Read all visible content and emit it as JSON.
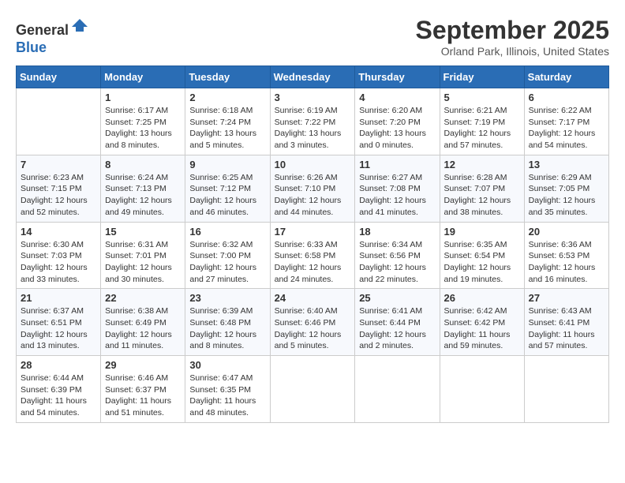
{
  "header": {
    "logo_line1": "General",
    "logo_line2": "Blue",
    "month": "September 2025",
    "location": "Orland Park, Illinois, United States"
  },
  "weekdays": [
    "Sunday",
    "Monday",
    "Tuesday",
    "Wednesday",
    "Thursday",
    "Friday",
    "Saturday"
  ],
  "weeks": [
    [
      {
        "day": "",
        "sunrise": "",
        "sunset": "",
        "daylight": ""
      },
      {
        "day": "1",
        "sunrise": "Sunrise: 6:17 AM",
        "sunset": "Sunset: 7:25 PM",
        "daylight": "Daylight: 13 hours and 8 minutes."
      },
      {
        "day": "2",
        "sunrise": "Sunrise: 6:18 AM",
        "sunset": "Sunset: 7:24 PM",
        "daylight": "Daylight: 13 hours and 5 minutes."
      },
      {
        "day": "3",
        "sunrise": "Sunrise: 6:19 AM",
        "sunset": "Sunset: 7:22 PM",
        "daylight": "Daylight: 13 hours and 3 minutes."
      },
      {
        "day": "4",
        "sunrise": "Sunrise: 6:20 AM",
        "sunset": "Sunset: 7:20 PM",
        "daylight": "Daylight: 13 hours and 0 minutes."
      },
      {
        "day": "5",
        "sunrise": "Sunrise: 6:21 AM",
        "sunset": "Sunset: 7:19 PM",
        "daylight": "Daylight: 12 hours and 57 minutes."
      },
      {
        "day": "6",
        "sunrise": "Sunrise: 6:22 AM",
        "sunset": "Sunset: 7:17 PM",
        "daylight": "Daylight: 12 hours and 54 minutes."
      }
    ],
    [
      {
        "day": "7",
        "sunrise": "Sunrise: 6:23 AM",
        "sunset": "Sunset: 7:15 PM",
        "daylight": "Daylight: 12 hours and 52 minutes."
      },
      {
        "day": "8",
        "sunrise": "Sunrise: 6:24 AM",
        "sunset": "Sunset: 7:13 PM",
        "daylight": "Daylight: 12 hours and 49 minutes."
      },
      {
        "day": "9",
        "sunrise": "Sunrise: 6:25 AM",
        "sunset": "Sunset: 7:12 PM",
        "daylight": "Daylight: 12 hours and 46 minutes."
      },
      {
        "day": "10",
        "sunrise": "Sunrise: 6:26 AM",
        "sunset": "Sunset: 7:10 PM",
        "daylight": "Daylight: 12 hours and 44 minutes."
      },
      {
        "day": "11",
        "sunrise": "Sunrise: 6:27 AM",
        "sunset": "Sunset: 7:08 PM",
        "daylight": "Daylight: 12 hours and 41 minutes."
      },
      {
        "day": "12",
        "sunrise": "Sunrise: 6:28 AM",
        "sunset": "Sunset: 7:07 PM",
        "daylight": "Daylight: 12 hours and 38 minutes."
      },
      {
        "day": "13",
        "sunrise": "Sunrise: 6:29 AM",
        "sunset": "Sunset: 7:05 PM",
        "daylight": "Daylight: 12 hours and 35 minutes."
      }
    ],
    [
      {
        "day": "14",
        "sunrise": "Sunrise: 6:30 AM",
        "sunset": "Sunset: 7:03 PM",
        "daylight": "Daylight: 12 hours and 33 minutes."
      },
      {
        "day": "15",
        "sunrise": "Sunrise: 6:31 AM",
        "sunset": "Sunset: 7:01 PM",
        "daylight": "Daylight: 12 hours and 30 minutes."
      },
      {
        "day": "16",
        "sunrise": "Sunrise: 6:32 AM",
        "sunset": "Sunset: 7:00 PM",
        "daylight": "Daylight: 12 hours and 27 minutes."
      },
      {
        "day": "17",
        "sunrise": "Sunrise: 6:33 AM",
        "sunset": "Sunset: 6:58 PM",
        "daylight": "Daylight: 12 hours and 24 minutes."
      },
      {
        "day": "18",
        "sunrise": "Sunrise: 6:34 AM",
        "sunset": "Sunset: 6:56 PM",
        "daylight": "Daylight: 12 hours and 22 minutes."
      },
      {
        "day": "19",
        "sunrise": "Sunrise: 6:35 AM",
        "sunset": "Sunset: 6:54 PM",
        "daylight": "Daylight: 12 hours and 19 minutes."
      },
      {
        "day": "20",
        "sunrise": "Sunrise: 6:36 AM",
        "sunset": "Sunset: 6:53 PM",
        "daylight": "Daylight: 12 hours and 16 minutes."
      }
    ],
    [
      {
        "day": "21",
        "sunrise": "Sunrise: 6:37 AM",
        "sunset": "Sunset: 6:51 PM",
        "daylight": "Daylight: 12 hours and 13 minutes."
      },
      {
        "day": "22",
        "sunrise": "Sunrise: 6:38 AM",
        "sunset": "Sunset: 6:49 PM",
        "daylight": "Daylight: 12 hours and 11 minutes."
      },
      {
        "day": "23",
        "sunrise": "Sunrise: 6:39 AM",
        "sunset": "Sunset: 6:48 PM",
        "daylight": "Daylight: 12 hours and 8 minutes."
      },
      {
        "day": "24",
        "sunrise": "Sunrise: 6:40 AM",
        "sunset": "Sunset: 6:46 PM",
        "daylight": "Daylight: 12 hours and 5 minutes."
      },
      {
        "day": "25",
        "sunrise": "Sunrise: 6:41 AM",
        "sunset": "Sunset: 6:44 PM",
        "daylight": "Daylight: 12 hours and 2 minutes."
      },
      {
        "day": "26",
        "sunrise": "Sunrise: 6:42 AM",
        "sunset": "Sunset: 6:42 PM",
        "daylight": "Daylight: 11 hours and 59 minutes."
      },
      {
        "day": "27",
        "sunrise": "Sunrise: 6:43 AM",
        "sunset": "Sunset: 6:41 PM",
        "daylight": "Daylight: 11 hours and 57 minutes."
      }
    ],
    [
      {
        "day": "28",
        "sunrise": "Sunrise: 6:44 AM",
        "sunset": "Sunset: 6:39 PM",
        "daylight": "Daylight: 11 hours and 54 minutes."
      },
      {
        "day": "29",
        "sunrise": "Sunrise: 6:46 AM",
        "sunset": "Sunset: 6:37 PM",
        "daylight": "Daylight: 11 hours and 51 minutes."
      },
      {
        "day": "30",
        "sunrise": "Sunrise: 6:47 AM",
        "sunset": "Sunset: 6:35 PM",
        "daylight": "Daylight: 11 hours and 48 minutes."
      },
      {
        "day": "",
        "sunrise": "",
        "sunset": "",
        "daylight": ""
      },
      {
        "day": "",
        "sunrise": "",
        "sunset": "",
        "daylight": ""
      },
      {
        "day": "",
        "sunrise": "",
        "sunset": "",
        "daylight": ""
      },
      {
        "day": "",
        "sunrise": "",
        "sunset": "",
        "daylight": ""
      }
    ]
  ]
}
